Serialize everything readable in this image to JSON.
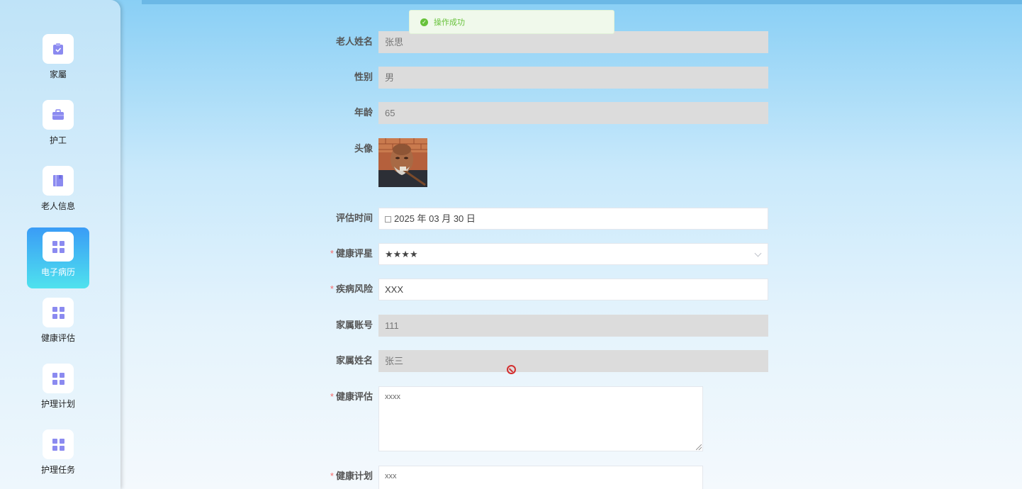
{
  "sidebar": {
    "items": [
      {
        "label": "家屬",
        "icon": "clipboard-check-icon",
        "active": false
      },
      {
        "label": "护工",
        "icon": "briefcase-icon",
        "active": false
      },
      {
        "label": "老人信息",
        "icon": "book-icon",
        "active": false
      },
      {
        "label": "电子病历",
        "icon": "grid-icon",
        "active": true
      },
      {
        "label": "健康评估",
        "icon": "grid-icon",
        "active": false
      },
      {
        "label": "护理计划",
        "icon": "grid-icon",
        "active": false
      },
      {
        "label": "护理任务",
        "icon": "grid-icon",
        "active": false
      }
    ]
  },
  "toast": {
    "message": "操作成功",
    "type": "success"
  },
  "form": {
    "elder_name": {
      "label": "老人姓名",
      "value": "张思"
    },
    "gender": {
      "label": "性别",
      "value": "男"
    },
    "age": {
      "label": "年龄",
      "value": "65"
    },
    "avatar": {
      "label": "头像"
    },
    "assess_time": {
      "label": "评估时间",
      "value": "2025 年 03 月 30 日"
    },
    "health_rating": {
      "label": "健康评星",
      "value": "★★★★",
      "required": true
    },
    "disease_risk": {
      "label": "疾病风险",
      "value": "XXX",
      "required": true
    },
    "family_account": {
      "label": "家属账号",
      "value": "111"
    },
    "family_name": {
      "label": "家属姓名",
      "value": "张三"
    },
    "health_assessment": {
      "label": "健康评估",
      "value": "xxxx",
      "required": true
    },
    "health_plan": {
      "label": "健康计划",
      "value": "xxx",
      "required": true
    }
  },
  "colors": {
    "accent": "#3a9cf6",
    "success": "#67c23a",
    "required": "#f56c6c",
    "icon": "#8b8af0"
  }
}
